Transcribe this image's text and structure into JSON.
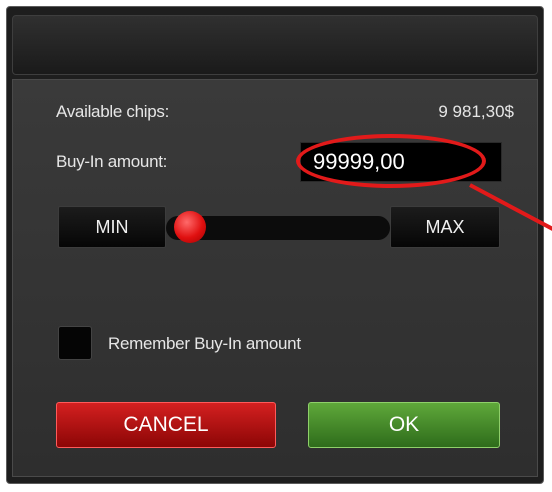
{
  "dialog": {
    "available_chips_label": "Available chips:",
    "available_chips_value": "9 981,30$",
    "buy_in_label": "Buy-In amount:",
    "buy_in_value": "99999,00",
    "min_label": "MIN",
    "max_label": "MAX",
    "slider_level": 0,
    "remember_label": "Remember Buy-In amount",
    "remember_checked": false,
    "cancel_label": "CANCEL",
    "ok_label": "OK"
  },
  "colors": {
    "annotation": "#e21a1a",
    "cancel": "#c01414",
    "ok": "#4f9a2e",
    "slider_thumb": "#e01010"
  }
}
